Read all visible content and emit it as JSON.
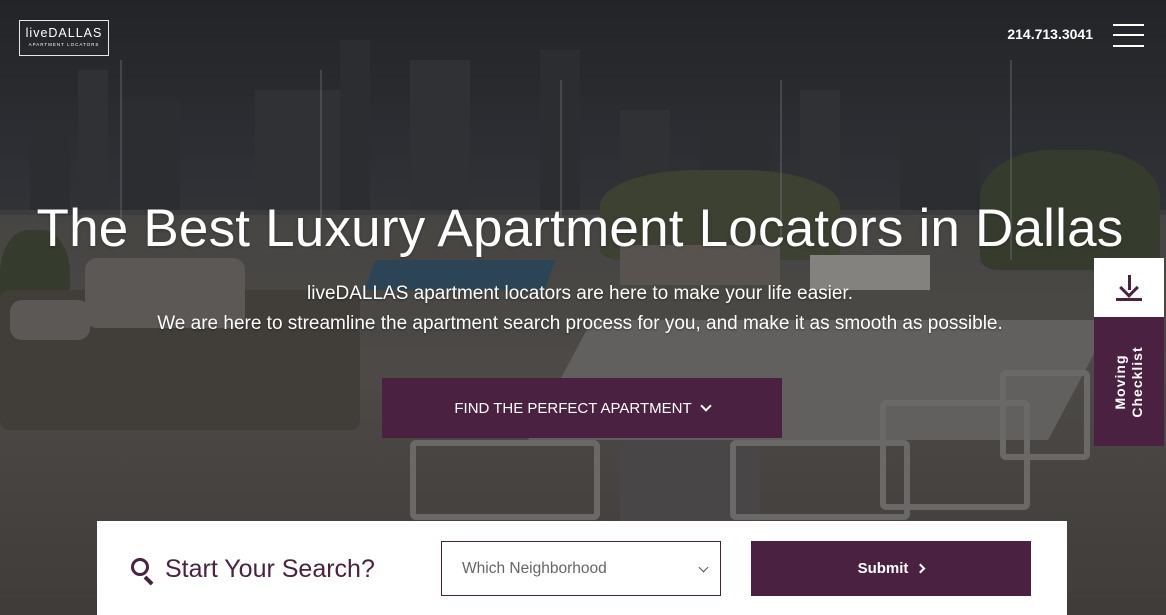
{
  "header": {
    "logo_live": "live",
    "logo_brand": "DALLAS",
    "logo_tagline": "APARTMENT LOCATORS",
    "phone": "214.713.3041"
  },
  "hero": {
    "title": "The Best Luxury Apartment Locators in Dallas",
    "subtitle_line1": "liveDALLAS apartment locators are here to make your life easier.",
    "subtitle_line2": "We are here to streamline the apartment search process for you, and make it as smooth as possible.",
    "cta_label": "FIND THE PERFECT APARTMENT"
  },
  "side_tab": {
    "download_icon": "download-icon",
    "checklist_line1": "Moving",
    "checklist_line2": "Checklist"
  },
  "search": {
    "icon": "search-icon",
    "label": "Start Your Search?",
    "neighborhood_value": "Which Neighborhood",
    "submit_label": "Submit"
  },
  "colors": {
    "brand": "#4a2140",
    "white": "#ffffff"
  }
}
